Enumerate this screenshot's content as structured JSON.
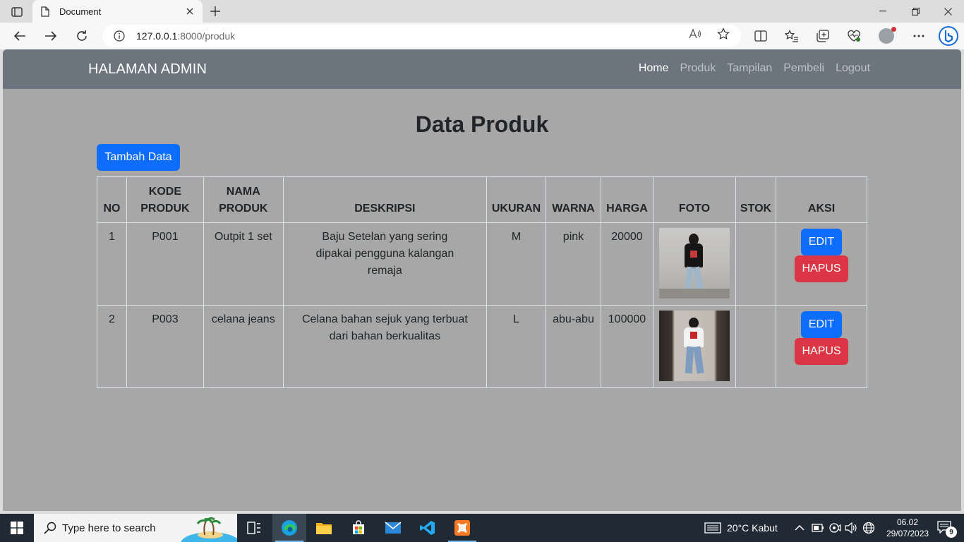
{
  "browser": {
    "tab_title": "Document",
    "url_host": "127.0.0.1",
    "url_rest": ":8000/produk"
  },
  "navbar": {
    "brand": "HALAMAN ADMIN",
    "links": [
      "Home",
      "Produk",
      "Tampilan",
      "Pembeli",
      "Logout"
    ],
    "active_link": "Home"
  },
  "main": {
    "title": "Data Produk",
    "add_button": "Tambah Data"
  },
  "table": {
    "headers": [
      "NO",
      "KODE PRODUK",
      "NAMA PRODUK",
      "DESKRIPSI",
      "UKURAN",
      "WARNA",
      "HARGA",
      "FOTO",
      "STOK",
      "AKSI"
    ],
    "rows": [
      {
        "no": "1",
        "kode": "P001",
        "nama": "Outpit 1 set",
        "deskripsi": "Baju Setelan yang sering dipakai pengguna kalangan remaja",
        "ukuran": "M",
        "warna": "pink",
        "harga": "20000",
        "foto": "photo-person-black-tshirt",
        "stok": "",
        "edit_label": "EDIT",
        "delete_label": "HAPUS"
      },
      {
        "no": "2",
        "kode": "P003",
        "nama": "celana jeans",
        "deskripsi": "Celana bahan sejuk yang terbuat dari bahan berkualitas",
        "ukuran": "L",
        "warna": "abu-abu",
        "harga": "100000",
        "foto": "photo-person-jeans",
        "stok": "",
        "edit_label": "EDIT",
        "delete_label": "HAPUS"
      }
    ]
  },
  "taskbar": {
    "search_placeholder": "Type here to search",
    "weather": "20°C  Kabut",
    "time": "06.02",
    "date": "29/07/2023",
    "notification_count": "9"
  },
  "colors": {
    "navbar": "#6c757d",
    "page_bg": "#a7a7a7",
    "primary": "#0d6efd",
    "danger": "#dc3545",
    "taskbar": "#1f2a35"
  }
}
